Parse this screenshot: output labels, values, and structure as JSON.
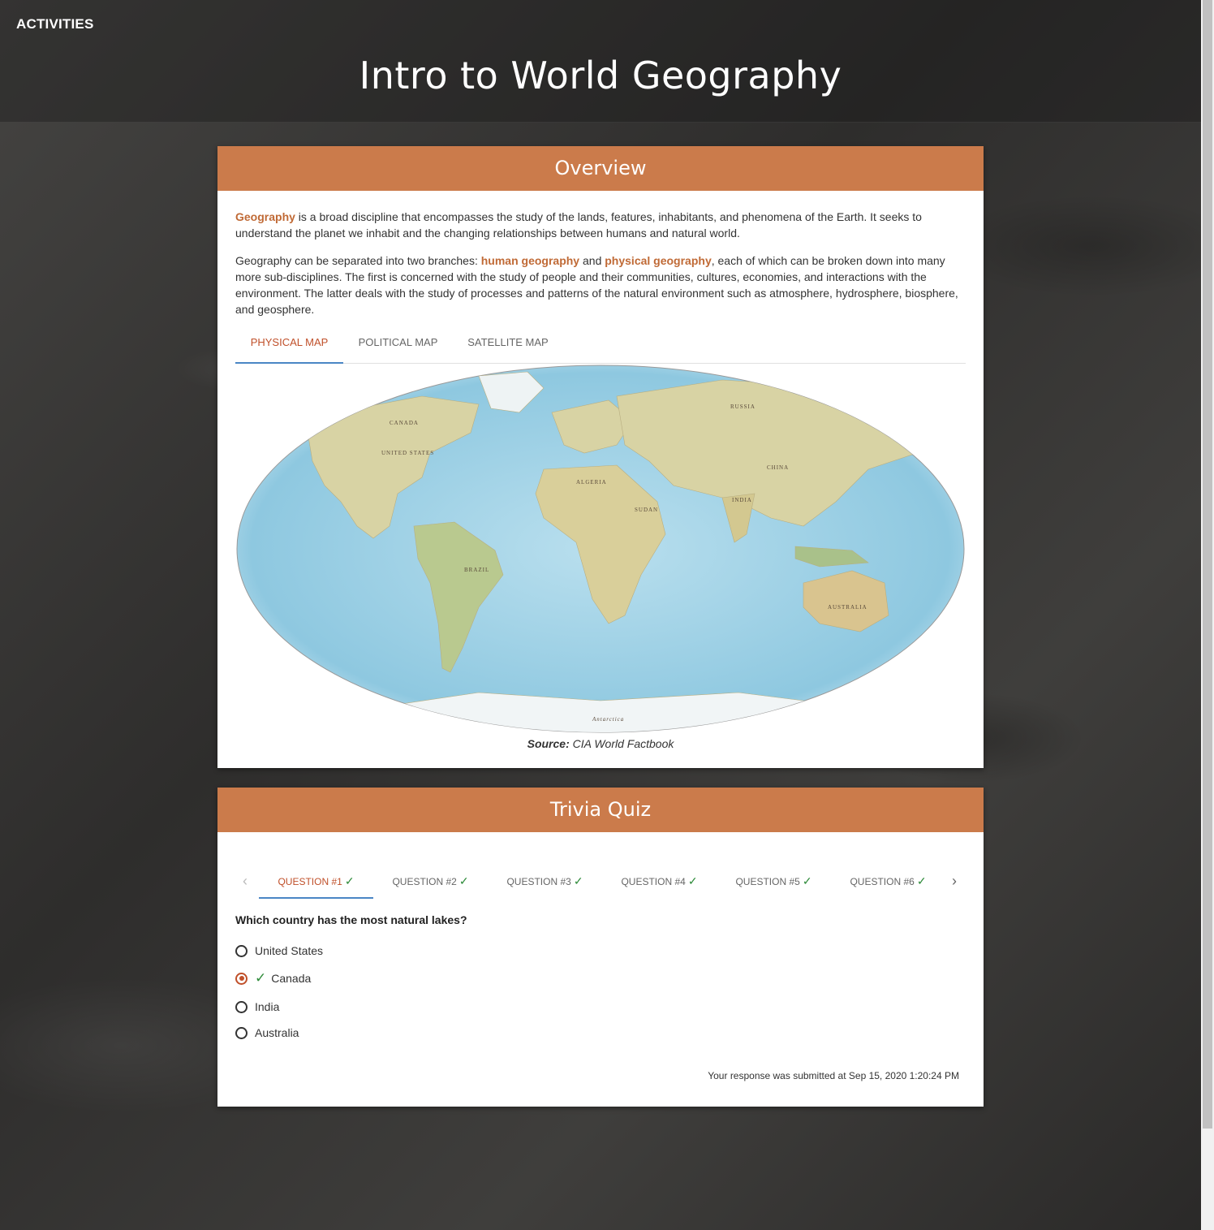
{
  "header": {
    "activities_label": "ACTIVITIES",
    "title": "Intro to World Geography"
  },
  "overview": {
    "title": "Overview",
    "p1_highlight": "Geography",
    "p1_text": " is a broad discipline that encompasses the study of the lands, features, inhabitants, and phenomena of the Earth. It seeks to understand the planet we inhabit and the changing relationships between humans and natural world.",
    "p2_text_a": "Geography can be separated into two branches: ",
    "p2_highlight_a": "human geography",
    "p2_text_b": " and ",
    "p2_highlight_b": "physical geography",
    "p2_text_c": ", each of which can be broken down into many more sub-disciplines. The first is concerned with the study of people and their communities, cultures, economies, and interactions with the environment. The latter deals with the study of processes and patterns of the natural environment such as atmosphere, hydrosphere, biosphere, and geosphere.",
    "tabs": [
      "PHYSICAL MAP",
      "POLITICAL MAP",
      "SATELLITE MAP"
    ],
    "active_tab": "PHYSICAL MAP",
    "map_labels": [
      "CANADA",
      "UNITED STATES",
      "BRAZIL",
      "RUSSIA",
      "CHINA",
      "INDIA",
      "AUSTRALIA",
      "ALGERIA",
      "SUDAN",
      "Antarctica"
    ],
    "source_label": "Source:",
    "source_value": "CIA World Factbook"
  },
  "quiz": {
    "title": "Trivia Quiz",
    "tabs": [
      {
        "label": "QUESTION #1",
        "done": true
      },
      {
        "label": "QUESTION #2",
        "done": true
      },
      {
        "label": "QUESTION #3",
        "done": true
      },
      {
        "label": "QUESTION #4",
        "done": true
      },
      {
        "label": "QUESTION #5",
        "done": true
      },
      {
        "label": "QUESTION #6",
        "done": true
      }
    ],
    "check_glyph": "✓",
    "prev_glyph": "‹",
    "next_glyph": "›",
    "question": "Which country has the most natural lakes?",
    "options": [
      "United States",
      "Canada",
      "India",
      "Australia"
    ],
    "selected": "Canada",
    "submitted_text": "Your response was submitted at Sep 15, 2020 1:20:24 PM"
  },
  "colors": {
    "accent": "#cb7b4b",
    "active_tab_text": "#c0502a",
    "tab_underline": "#4a86c5",
    "check": "#2e8b3a"
  }
}
